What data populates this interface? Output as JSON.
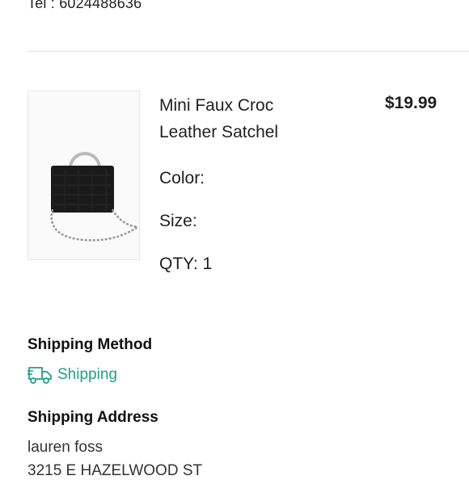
{
  "contact": {
    "tel": "Tel : 6024488636"
  },
  "order_item": {
    "name": "Mini Faux Croc Leather Satchel",
    "price": "$19.99",
    "color_label": "Color:",
    "size_label": "Size:",
    "qty_label": "QTY: 1"
  },
  "shipping": {
    "method_heading": "Shipping Method",
    "method": "Shipping",
    "address_heading": "Shipping Address",
    "address_name": "lauren foss",
    "address_street": "3215 E HAZELWOOD ST"
  },
  "colors": {
    "accent": "#1f9f8a",
    "divider": "#e2e2e2"
  },
  "icons": {
    "shipping": "truck-icon"
  }
}
